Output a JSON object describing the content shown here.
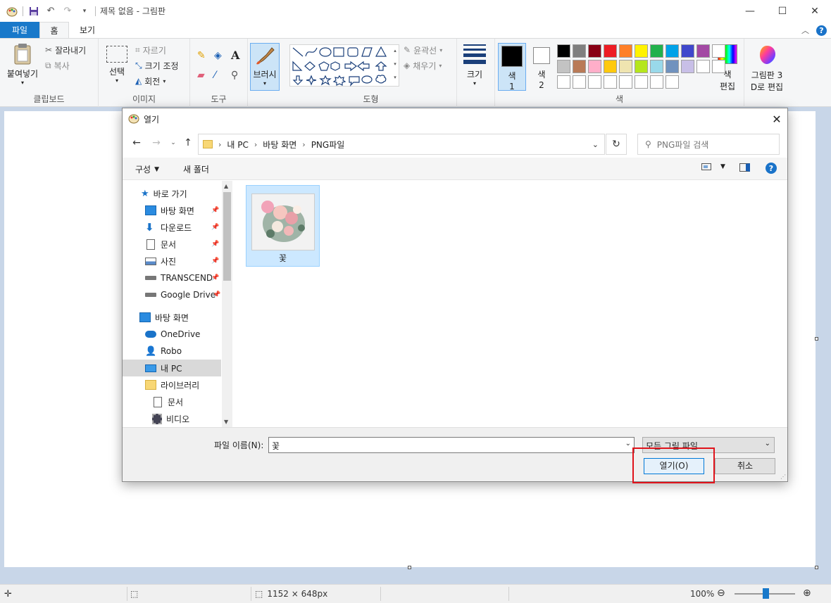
{
  "titlebar": {
    "title": "제목 없음 - 그림판",
    "quick_access": [
      "paint-app-icon",
      "save-icon",
      "undo-icon",
      "redo-icon",
      "customize-icon"
    ]
  },
  "tabs": {
    "file": "파일",
    "home": "홈",
    "view": "보기"
  },
  "ribbon": {
    "clipboard": {
      "paste": "붙여넣기",
      "cut": "잘라내기",
      "copy": "복사",
      "label": "클립보드"
    },
    "image": {
      "select": "선택",
      "crop": "자르기",
      "resize": "크기 조정",
      "rotate": "회전",
      "label": "이미지"
    },
    "tools": {
      "label": "도구",
      "brush": "브러시"
    },
    "shapes": {
      "outline": "윤곽선",
      "fill": "채우기",
      "label": "도형"
    },
    "size": {
      "label": "크기"
    },
    "colors": {
      "color1": "색",
      "color1_num": "1",
      "color2": "색",
      "color2_num": "2",
      "edit_line1": "색",
      "edit_line2": "편집",
      "label": "색",
      "palette": [
        "#000000",
        "#7f7f7f",
        "#880015",
        "#ed1c24",
        "#ff7f27",
        "#fff200",
        "#22b14c",
        "#00a2e8",
        "#3f48cc",
        "#a349a4",
        "#ffffff",
        "#c3c3c3",
        "#b97a57",
        "#ffaec9",
        "#ffc90e",
        "#efe4b0",
        "#b5e61d",
        "#99d9ea",
        "#7092be",
        "#c8bfe7",
        "#ffffff",
        "#ffffff",
        "#ffffff",
        "#ffffff",
        "#ffffff",
        "#ffffff",
        "#ffffff",
        "#ffffff",
        "#ffffff",
        "#ffffff"
      ]
    },
    "paint3d": {
      "line1": "그림판 3",
      "line2": "D로 편집"
    }
  },
  "dialog": {
    "title": "열기",
    "breadcrumb": [
      "내 PC",
      "바탕 화면",
      "PNG파일"
    ],
    "search_placeholder": "PNG파일 검색",
    "organize": "구성",
    "new_folder": "새 폴더",
    "nav": {
      "quick_access": "바로 가기",
      "desktop_pinned": "바탕 화면",
      "downloads": "다운로드",
      "documents": "문서",
      "pictures": "사진",
      "transcend": "TRANSCEND",
      "google_drive": "Google Drive",
      "desktop": "바탕 화면",
      "onedrive": "OneDrive",
      "robo": "Robo",
      "this_pc": "내 PC",
      "library": "라이브러리",
      "lib_docs": "문서",
      "lib_video": "비디오"
    },
    "files": [
      {
        "name": "꽃"
      }
    ],
    "filename_label": "파일 이름(N):",
    "filename_value": "꽃",
    "filetype": "모든 그림 파일",
    "open_button": "열기(O)",
    "cancel_button": "취소"
  },
  "statusbar": {
    "dimensions": "1152 × 648px",
    "zoom": "100%"
  }
}
